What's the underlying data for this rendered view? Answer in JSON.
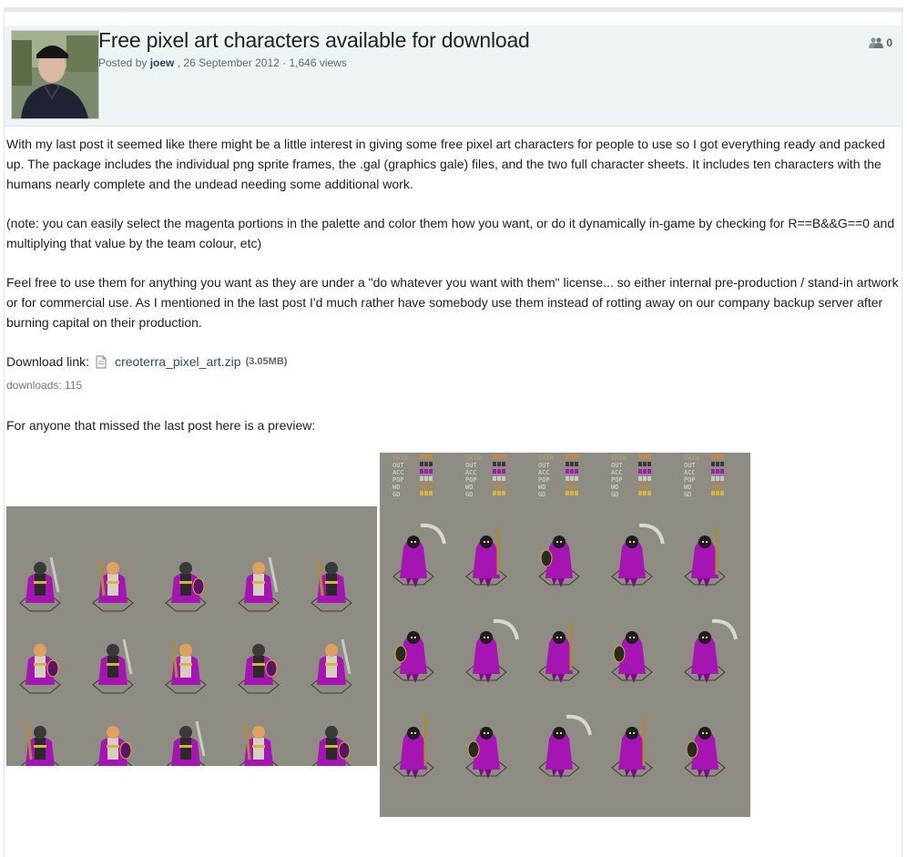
{
  "post": {
    "title": "Free pixel art characters available for download",
    "posted_by_prefix": "Posted by",
    "author": "joew",
    "date_views": ", 26 September 2012 · 1,646 views",
    "reputation": "0"
  },
  "body": {
    "p1": "With my last post it seemed like there might be a little interest in giving some free pixel art characters for people to use so I got everything ready and packed up. The package includes the individual png sprite frames, the .gal (graphics gale) files, and the two full character sheets. It includes ten characters with the humans nearly complete and the undead needing some additional work.",
    "p2": "(note: you can easily select the magenta portions in the palette and color them how you want, or do it dynamically in-game by checking for R==B&&G==0 and multiplying that value by the team colour, etc)",
    "p3": "Feel free to use them for anything you want as they are under a \"do whatever you want with them\" license... so either internal pre-production / stand-in artwork or for commercial use. As I mentioned in the last post I'd much rather have somebody use them instead of rotting away on our company backup server after burning capital on their production.",
    "download_label": "Download link:",
    "download_file": "creoterra_pixel_art.zip",
    "download_size": "(3.05MB)",
    "downloads": "downloads: 115",
    "p4": "For anyone that missed the last post here is a preview:"
  },
  "icons": {
    "avatar": "avatar-photo",
    "reputation": "people-icon",
    "file": "file-icon"
  },
  "colors": {
    "magenta": "#a614b4",
    "sprite_bg": "#8f8c83",
    "header_bg": "#eef3f5",
    "link": "#2c4c6e"
  },
  "palette_labels": [
    "SKIN",
    "OUT",
    "ACC",
    "POP",
    "WD",
    "GD"
  ]
}
